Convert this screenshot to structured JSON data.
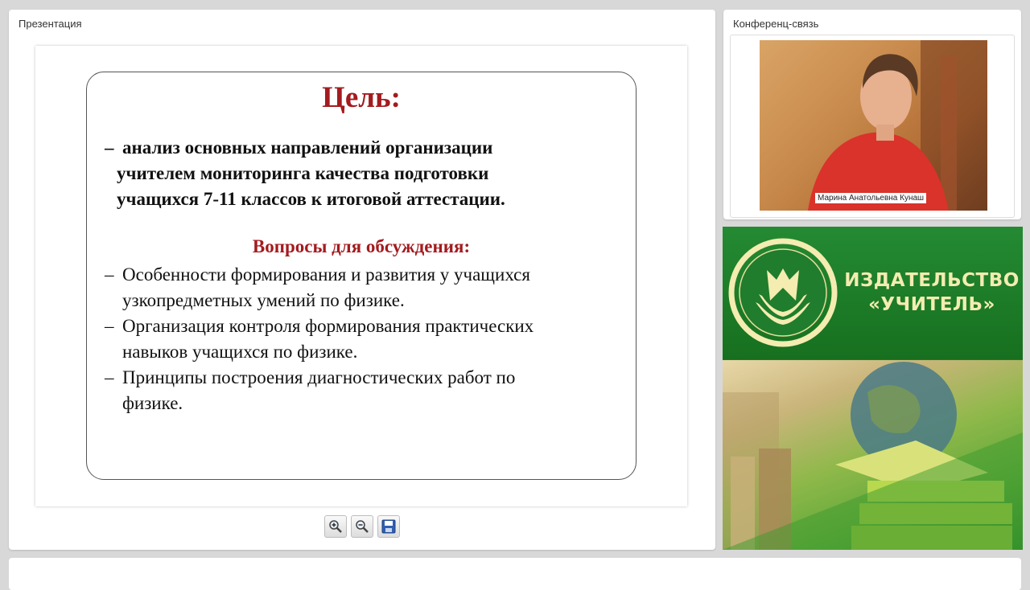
{
  "presentation": {
    "panel_title": "Презентация",
    "slide": {
      "heading": "Цель:",
      "goal_dash": "–",
      "goal_lines": [
        "анализ основных направлений организации",
        "учителем мониторинга качества подготовки",
        "учащихся 7-11 классов к итоговой аттестации."
      ],
      "questions_heading": "Вопросы для обсуждения:",
      "questions": [
        {
          "dash": "–",
          "lines": [
            "Особенности формирования и развития у учащихся",
            "узкопредметных умений по физике."
          ]
        },
        {
          "dash": "–",
          "lines": [
            "Организация контроля формирования практических",
            "навыков учащихся по физике."
          ]
        },
        {
          "dash": "–",
          "lines": [
            "Принципы построения диагностических работ по",
            "физике."
          ]
        }
      ],
      "heading_color": "#a31b1f"
    },
    "toolbar": {
      "zoom_in_icon": "zoom-in-icon",
      "zoom_out_icon": "zoom-out-icon",
      "save_icon": "floppy-disk-icon"
    }
  },
  "conference": {
    "panel_title": "Конференц-связь",
    "participant_name": "Марина Анатольевна Кунаш"
  },
  "ad": {
    "publisher_line1": "ИЗДАТЕЛЬСТВО",
    "publisher_line2": "«УЧИТЕЛЬ»",
    "brand_color": "#1c7a2b",
    "text_color": "#f4ecb0"
  }
}
